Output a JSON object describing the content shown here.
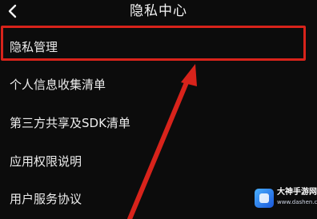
{
  "header": {
    "title": "隐私中心",
    "back_icon": "chevron-left-icon"
  },
  "menu": {
    "items": [
      {
        "label": "隐私管理",
        "highlighted": true
      },
      {
        "label": "个人信息收集清单",
        "highlighted": false
      },
      {
        "label": "第三方共享及SDK清单",
        "highlighted": false
      },
      {
        "label": "应用权限说明",
        "highlighted": false
      },
      {
        "label": "用户服务协议",
        "highlighted": false
      }
    ]
  },
  "annotation": {
    "color": "#d8231b",
    "arrow_icon": "red-arrow-icon"
  },
  "watermark": {
    "title": "大神手游网",
    "subtitle": "www.dashen.com"
  }
}
